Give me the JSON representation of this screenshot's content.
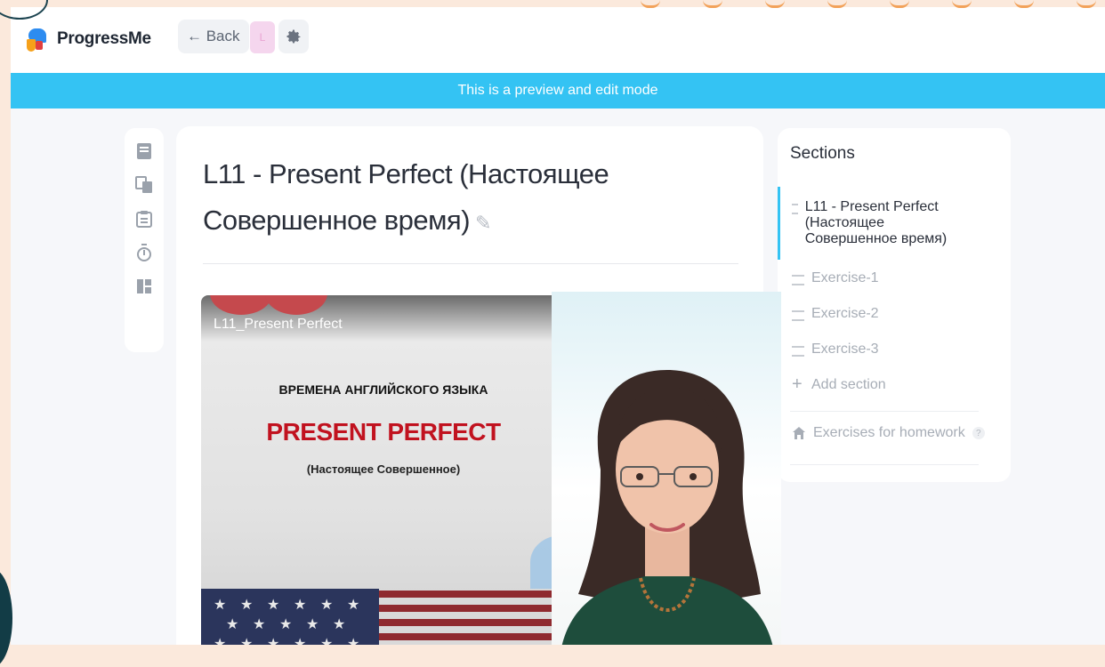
{
  "app": {
    "name": "ProgressMe"
  },
  "header": {
    "back_label": "← Back",
    "avatar_letter": "L"
  },
  "banner": {
    "text": "This is a preview and edit mode"
  },
  "lesson": {
    "title": "L11 - Present Perfect (Настоящее Совершенное время)"
  },
  "video": {
    "label": "L11_Present Perfect",
    "slide_subtitle": "ВРЕМЕНА АНГЛИЙСКОГО ЯЗЫКА",
    "slide_title": "PRESENT PERFECT",
    "slide_caption": "(Настоящее Совершенное)"
  },
  "sections": {
    "heading": "Sections",
    "items": [
      {
        "label": "L11 - Present Perfect (Настоящее Совершенное время)",
        "active": true
      },
      {
        "label": "Exercise-1",
        "active": false
      },
      {
        "label": "Exercise-2",
        "active": false
      },
      {
        "label": "Exercise-3",
        "active": false
      }
    ],
    "add_label": "Add section",
    "homework_label": "Exercises for homework",
    "homework_hint": "?"
  },
  "colors": {
    "banner": "#34c3f3",
    "title_text": "#2a2f3a",
    "slide_red": "#c1121f",
    "muted": "#a7adb6"
  },
  "icons": [
    "book-icon",
    "translate-icon",
    "clipboard-icon",
    "timer-icon",
    "layout-icon",
    "gear-icon",
    "pencil-icon",
    "home-icon",
    "drag-handle-icon",
    "plus-icon"
  ]
}
